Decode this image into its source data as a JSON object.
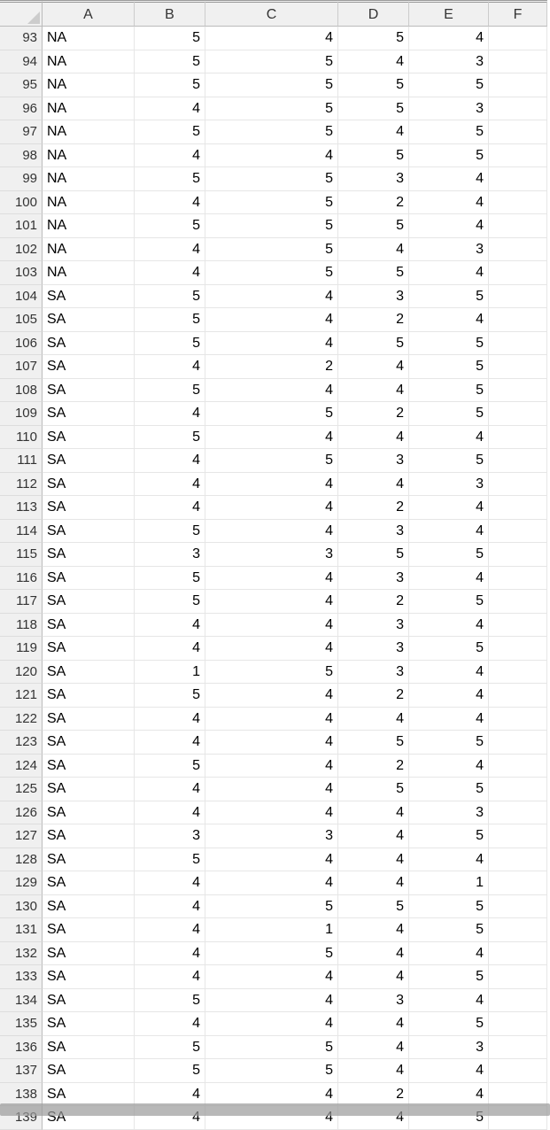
{
  "columns": [
    "A",
    "B",
    "C",
    "D",
    "E",
    "F"
  ],
  "startRow": 93,
  "rows": [
    {
      "n": 93,
      "a": "NA",
      "b": 5,
      "c": 4,
      "d": 5,
      "e": 4
    },
    {
      "n": 94,
      "a": "NA",
      "b": 5,
      "c": 5,
      "d": 4,
      "e": 3
    },
    {
      "n": 95,
      "a": "NA",
      "b": 5,
      "c": 5,
      "d": 5,
      "e": 5
    },
    {
      "n": 96,
      "a": "NA",
      "b": 4,
      "c": 5,
      "d": 5,
      "e": 3
    },
    {
      "n": 97,
      "a": "NA",
      "b": 5,
      "c": 5,
      "d": 4,
      "e": 5
    },
    {
      "n": 98,
      "a": "NA",
      "b": 4,
      "c": 4,
      "d": 5,
      "e": 5
    },
    {
      "n": 99,
      "a": "NA",
      "b": 5,
      "c": 5,
      "d": 3,
      "e": 4
    },
    {
      "n": 100,
      "a": "NA",
      "b": 4,
      "c": 5,
      "d": 2,
      "e": 4
    },
    {
      "n": 101,
      "a": "NA",
      "b": 5,
      "c": 5,
      "d": 5,
      "e": 4
    },
    {
      "n": 102,
      "a": "NA",
      "b": 4,
      "c": 5,
      "d": 4,
      "e": 3
    },
    {
      "n": 103,
      "a": "NA",
      "b": 4,
      "c": 5,
      "d": 5,
      "e": 4
    },
    {
      "n": 104,
      "a": "SA",
      "b": 5,
      "c": 4,
      "d": 3,
      "e": 5
    },
    {
      "n": 105,
      "a": "SA",
      "b": 5,
      "c": 4,
      "d": 2,
      "e": 4
    },
    {
      "n": 106,
      "a": "SA",
      "b": 5,
      "c": 4,
      "d": 5,
      "e": 5
    },
    {
      "n": 107,
      "a": "SA",
      "b": 4,
      "c": 2,
      "d": 4,
      "e": 5
    },
    {
      "n": 108,
      "a": "SA",
      "b": 5,
      "c": 4,
      "d": 4,
      "e": 5
    },
    {
      "n": 109,
      "a": "SA",
      "b": 4,
      "c": 5,
      "d": 2,
      "e": 5
    },
    {
      "n": 110,
      "a": "SA",
      "b": 5,
      "c": 4,
      "d": 4,
      "e": 4
    },
    {
      "n": 111,
      "a": "SA",
      "b": 4,
      "c": 5,
      "d": 3,
      "e": 5
    },
    {
      "n": 112,
      "a": "SA",
      "b": 4,
      "c": 4,
      "d": 4,
      "e": 3
    },
    {
      "n": 113,
      "a": "SA",
      "b": 4,
      "c": 4,
      "d": 2,
      "e": 4
    },
    {
      "n": 114,
      "a": "SA",
      "b": 5,
      "c": 4,
      "d": 3,
      "e": 4
    },
    {
      "n": 115,
      "a": "SA",
      "b": 3,
      "c": 3,
      "d": 5,
      "e": 5
    },
    {
      "n": 116,
      "a": "SA",
      "b": 5,
      "c": 4,
      "d": 3,
      "e": 4
    },
    {
      "n": 117,
      "a": "SA",
      "b": 5,
      "c": 4,
      "d": 2,
      "e": 5
    },
    {
      "n": 118,
      "a": "SA",
      "b": 4,
      "c": 4,
      "d": 3,
      "e": 4
    },
    {
      "n": 119,
      "a": "SA",
      "b": 4,
      "c": 4,
      "d": 3,
      "e": 5
    },
    {
      "n": 120,
      "a": "SA",
      "b": 1,
      "c": 5,
      "d": 3,
      "e": 4
    },
    {
      "n": 121,
      "a": "SA",
      "b": 5,
      "c": 4,
      "d": 2,
      "e": 4
    },
    {
      "n": 122,
      "a": "SA",
      "b": 4,
      "c": 4,
      "d": 4,
      "e": 4
    },
    {
      "n": 123,
      "a": "SA",
      "b": 4,
      "c": 4,
      "d": 5,
      "e": 5
    },
    {
      "n": 124,
      "a": "SA",
      "b": 5,
      "c": 4,
      "d": 2,
      "e": 4
    },
    {
      "n": 125,
      "a": "SA",
      "b": 4,
      "c": 4,
      "d": 5,
      "e": 5
    },
    {
      "n": 126,
      "a": "SA",
      "b": 4,
      "c": 4,
      "d": 4,
      "e": 3
    },
    {
      "n": 127,
      "a": "SA",
      "b": 3,
      "c": 3,
      "d": 4,
      "e": 5
    },
    {
      "n": 128,
      "a": "SA",
      "b": 5,
      "c": 4,
      "d": 4,
      "e": 4
    },
    {
      "n": 129,
      "a": "SA",
      "b": 4,
      "c": 4,
      "d": 4,
      "e": 1
    },
    {
      "n": 130,
      "a": "SA",
      "b": 4,
      "c": 5,
      "d": 5,
      "e": 5
    },
    {
      "n": 131,
      "a": "SA",
      "b": 4,
      "c": 1,
      "d": 4,
      "e": 5
    },
    {
      "n": 132,
      "a": "SA",
      "b": 4,
      "c": 5,
      "d": 4,
      "e": 4
    },
    {
      "n": 133,
      "a": "SA",
      "b": 4,
      "c": 4,
      "d": 4,
      "e": 5
    },
    {
      "n": 134,
      "a": "SA",
      "b": 5,
      "c": 4,
      "d": 3,
      "e": 4
    },
    {
      "n": 135,
      "a": "SA",
      "b": 4,
      "c": 4,
      "d": 4,
      "e": 5
    },
    {
      "n": 136,
      "a": "SA",
      "b": 5,
      "c": 5,
      "d": 4,
      "e": 3
    },
    {
      "n": 137,
      "a": "SA",
      "b": 5,
      "c": 5,
      "d": 4,
      "e": 4
    },
    {
      "n": 138,
      "a": "SA",
      "b": 4,
      "c": 4,
      "d": 2,
      "e": 4
    },
    {
      "n": 139,
      "a": "SA",
      "b": 4,
      "c": 4,
      "d": 4,
      "e": 5
    }
  ]
}
